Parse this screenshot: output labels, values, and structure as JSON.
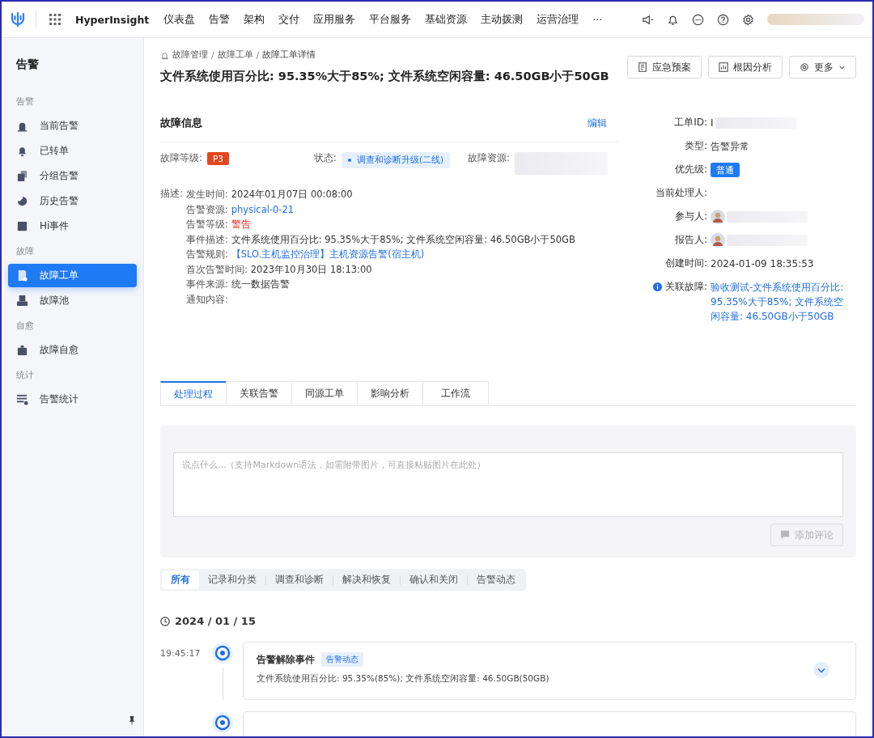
{
  "topbar": {
    "brand": "HyperInsight",
    "nav": [
      {
        "label": "仪表盘"
      },
      {
        "label": "告警"
      },
      {
        "label": "架构"
      },
      {
        "label": "交付"
      },
      {
        "label": "应用服务"
      },
      {
        "label": "平台服务"
      },
      {
        "label": "基础资源"
      },
      {
        "label": "主动拨测"
      },
      {
        "label": "运营治理"
      },
      {
        "label": "···"
      }
    ]
  },
  "sidebar": {
    "title": "告警",
    "groups": [
      {
        "label": "告警",
        "items": [
          {
            "label": "当前告警",
            "kind": "siren",
            "selected": false
          },
          {
            "label": "已转单",
            "kind": "bell",
            "selected": false
          },
          {
            "label": "分组告警",
            "kind": "stack",
            "selected": false
          },
          {
            "label": "历史告警",
            "kind": "history",
            "selected": false
          },
          {
            "label": "Hi事件",
            "kind": "hi",
            "selected": false
          }
        ]
      },
      {
        "label": "故障",
        "items": [
          {
            "label": "故障工单",
            "kind": "ticket",
            "selected": true
          },
          {
            "label": "故障池",
            "kind": "tray",
            "selected": false
          }
        ]
      },
      {
        "label": "自愈",
        "items": [
          {
            "label": "故障自愈",
            "kind": "kit",
            "selected": false
          }
        ]
      },
      {
        "label": "统计",
        "items": [
          {
            "label": "告警统计",
            "kind": "list",
            "selected": false
          }
        ]
      }
    ]
  },
  "breadcrumb": {
    "separator": "/",
    "items": [
      "故障管理",
      "故障工单",
      "故障工单详情"
    ]
  },
  "title": "文件系统使用百分比: 95.35%大于85%; 文件系统空闲容量: 46.50GB小于50GB",
  "actions": [
    {
      "label": "应急预案",
      "kind": "doc"
    },
    {
      "label": "根因分析",
      "kind": "chart"
    },
    {
      "label": "更多",
      "kind": "menu"
    }
  ],
  "fault_info": {
    "heading": "故障信息",
    "edit": "编辑",
    "level_label": "故障等级:",
    "level": "P3",
    "status_label": "状态:",
    "status": "调查和诊断升级(二线)",
    "resource_label": "故障资源:",
    "desc_label": "描述:",
    "desc": [
      {
        "label": "发生时间:",
        "value": "2024年01月07日 00:08:00",
        "kind": "text"
      },
      {
        "label": "告警资源:",
        "value": "physical-0-21",
        "kind": "link"
      },
      {
        "label": "告警等级:",
        "value": "警告",
        "kind": "danger"
      },
      {
        "label": "事件描述:",
        "value": "文件系统使用百分比: 95.35%大于85%; 文件系统空闲容量: 46.50GB小于50GB",
        "kind": "text"
      },
      {
        "label": "告警规则:",
        "value": "【SLO.主机监控治理】主机资源告警(宿主机)",
        "kind": "link"
      },
      {
        "label": "首次告警时间:",
        "value": "2023年10月30日 18:13:00",
        "kind": "text"
      },
      {
        "label": "事件来源:",
        "value": "统一数据告警",
        "kind": "text"
      },
      {
        "label": "通知内容:"
      }
    ]
  },
  "details": [
    {
      "label": "工单ID:",
      "value": "I",
      "kind": "blurred"
    },
    {
      "label": "类型:",
      "value": "告警异常",
      "kind": "text"
    },
    {
      "label": "优先级:",
      "value": "普通",
      "kind": "tag"
    },
    {
      "label": "当前处理人:",
      "kind": "empty"
    },
    {
      "label": "参与人:",
      "kind": "person"
    },
    {
      "label": "报告人:",
      "kind": "person"
    },
    {
      "label": "创建时间:",
      "value": "2024-01-09 18:35:53",
      "kind": "text"
    },
    {
      "label": "关联故障:",
      "value": "验收测试-文件系统使用百分比: 95.35%大于85%; 文件系统空闲容量: 46.50GB小于50GB",
      "kind": "link"
    }
  ],
  "tabs": [
    {
      "label": "处理过程",
      "selected": true
    },
    {
      "label": "关联告警",
      "selected": false
    },
    {
      "label": "同源工单",
      "selected": false
    },
    {
      "label": "影响分析",
      "selected": false
    },
    {
      "label": "工作流",
      "selected": false
    }
  ],
  "comment": {
    "placeholder": "说点什么...（支持Markdown语法，如需附带图片，可直接粘贴图片在此处）",
    "button": "添加评论",
    "disabled": true
  },
  "filters": [
    {
      "label": "所有",
      "selected": true
    },
    {
      "label": "记录和分类",
      "selected": false
    },
    {
      "label": "调查和诊断",
      "selected": false
    },
    {
      "label": "解决和恢复",
      "selected": false
    },
    {
      "label": "确认和关闭",
      "selected": false
    },
    {
      "label": "告警动态",
      "selected": false
    }
  ],
  "timeline": {
    "date": "2024 / 01 / 15",
    "events": [
      {
        "time": "19:45:17",
        "title": "告警解除事件",
        "tag": "告警动态",
        "text": "文件系统使用百分比: 95.35%(85%); 文件系统空闲容量: 46.50GB(50GB)"
      }
    ]
  }
}
